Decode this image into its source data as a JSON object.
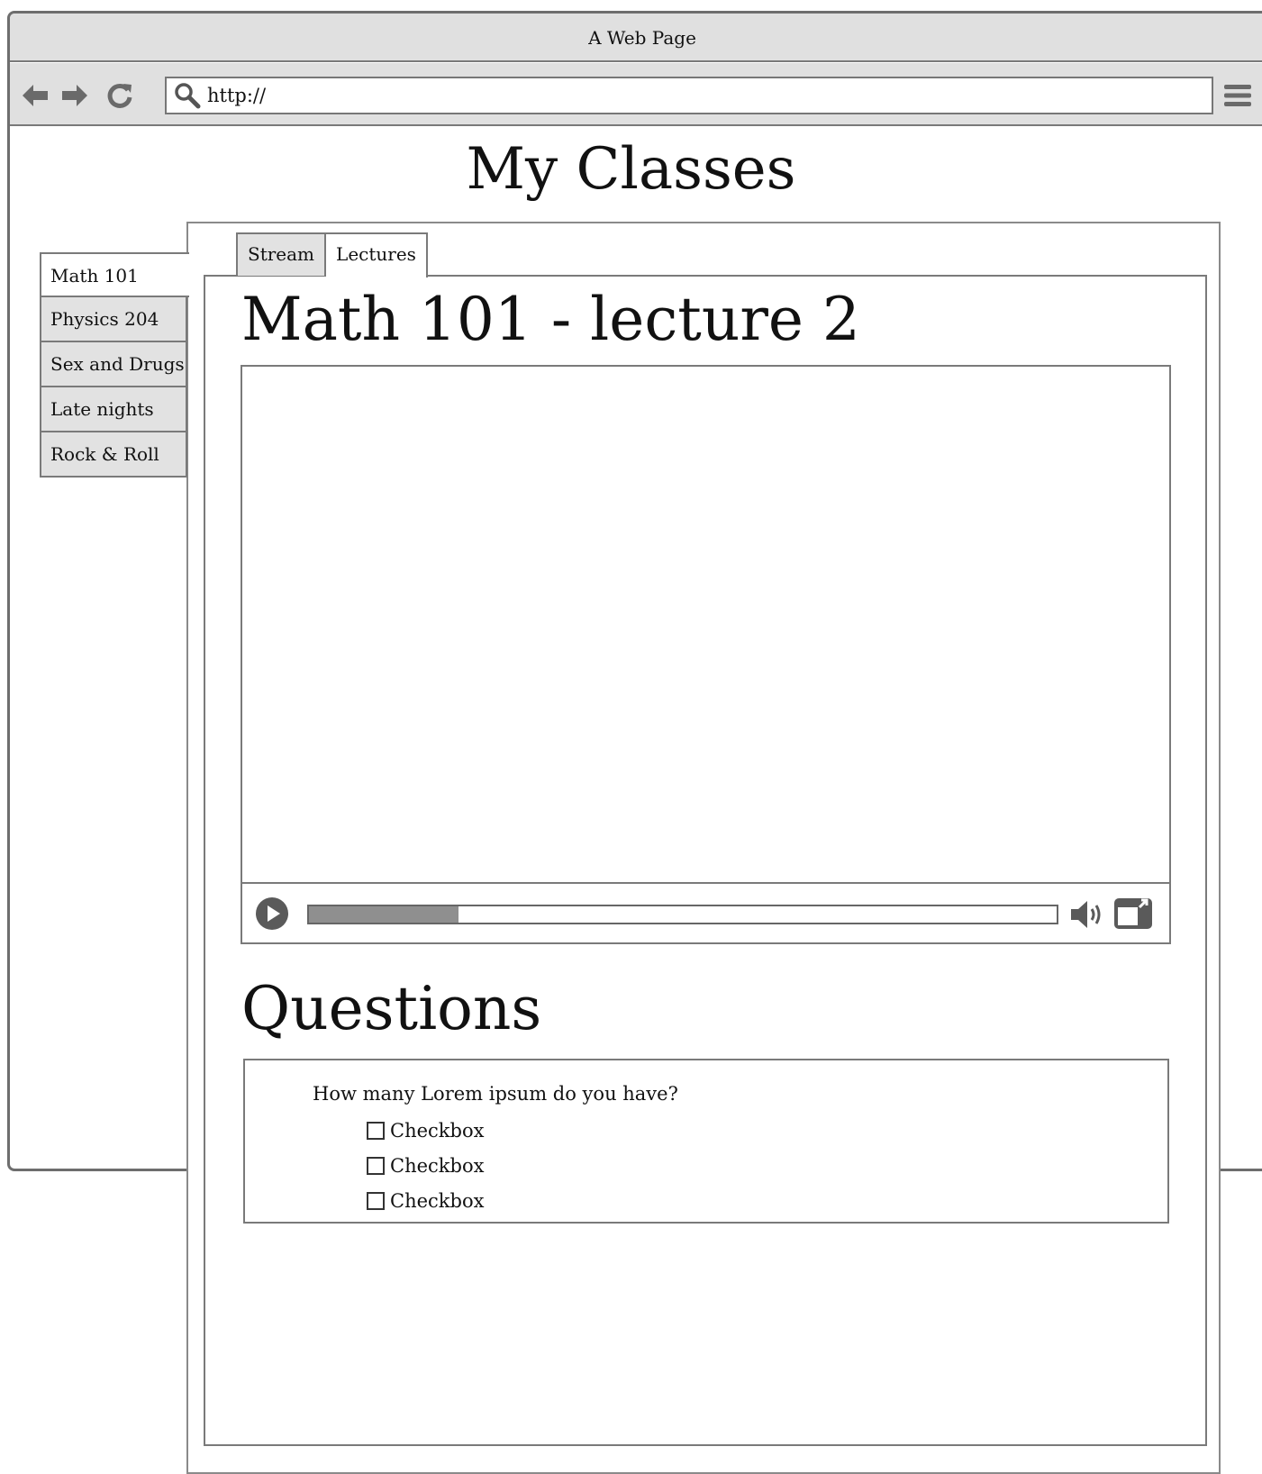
{
  "window": {
    "title": "A Web Page"
  },
  "toolbar": {
    "back_icon": "arrow-left-icon",
    "forward_icon": "arrow-right-icon",
    "reload_icon": "reload-icon",
    "search_icon": "search-icon",
    "menu_icon": "hamburger-menu-icon",
    "url": "http://"
  },
  "page": {
    "title": "My Classes"
  },
  "sidebar": {
    "items": [
      {
        "label": "Math 101",
        "active": true
      },
      {
        "label": "Physics 204",
        "active": false
      },
      {
        "label": "Sex and Drugs",
        "active": false
      },
      {
        "label": "Late nights",
        "active": false
      },
      {
        "label": "Rock & Roll",
        "active": false
      }
    ]
  },
  "tabs": [
    {
      "label": "Stream",
      "active": false
    },
    {
      "label": "Lectures",
      "active": true
    }
  ],
  "lecture": {
    "title": "Math 101 - lecture 2"
  },
  "video": {
    "progress": 0.2,
    "play_icon": "play-icon",
    "volume_icon": "volume-icon",
    "fullscreen_icon": "fullscreen-icon"
  },
  "questions": {
    "title": "Questions",
    "items": [
      {
        "text": "How many Lorem ipsum do you have?",
        "options": [
          "Checkbox",
          "Checkbox",
          "Checkbox"
        ]
      }
    ]
  }
}
